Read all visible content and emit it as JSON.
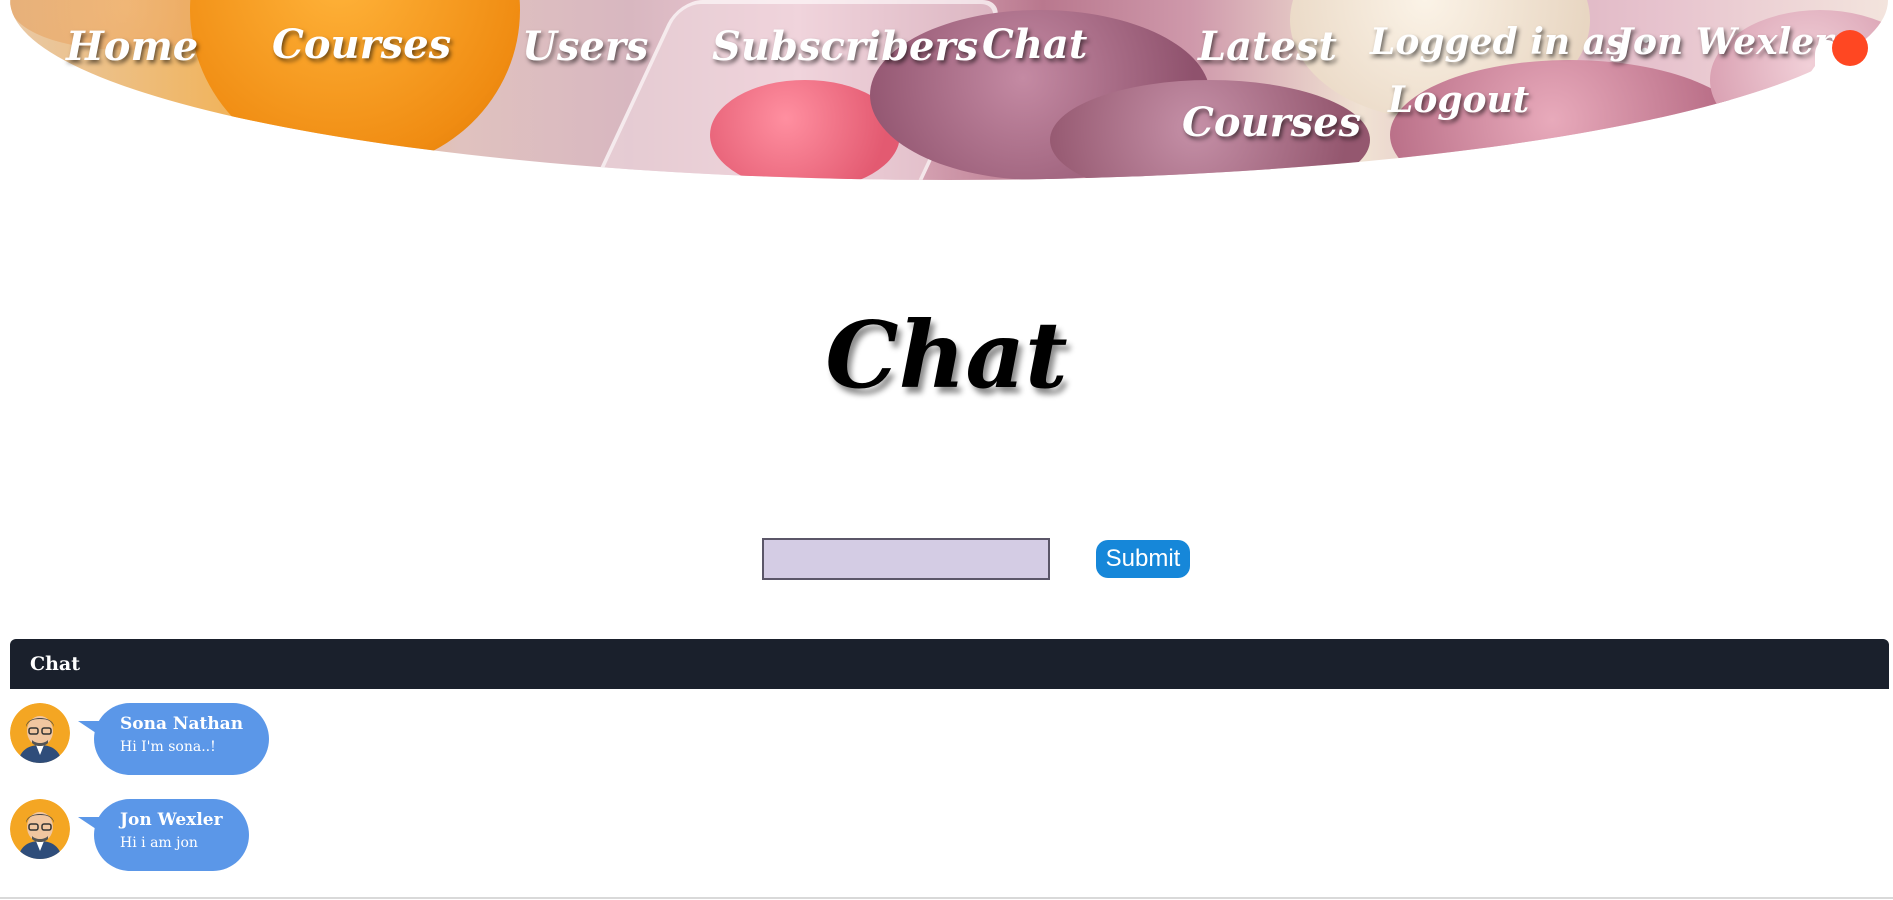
{
  "nav": {
    "home": "Home",
    "courses": "Courses",
    "users": "Users",
    "subscribers": "Subscribers",
    "chat": "Chat",
    "latest_courses_line1": "Latest",
    "latest_courses_line2": "Courses",
    "logged_in_as": "Logged in as :",
    "user_name": "Jon Wexler",
    "logout": "Logout"
  },
  "notification": {
    "icon": "bell-icon",
    "dot_color": "#ff4722"
  },
  "page": {
    "title": "Chat"
  },
  "form": {
    "input_value": "",
    "submit_label": "Submit"
  },
  "chat": {
    "header": "Chat",
    "messages": [
      {
        "sender": "Sona Nathan",
        "text": "Hi I'm sona..!"
      },
      {
        "sender": "Jon Wexler",
        "text": "Hi i am jon"
      }
    ]
  },
  "colors": {
    "chat_header_bg": "#1a202c",
    "bubble": "#5b97e8",
    "submit": "#1687d9",
    "input_bg": "#d4cce4"
  }
}
